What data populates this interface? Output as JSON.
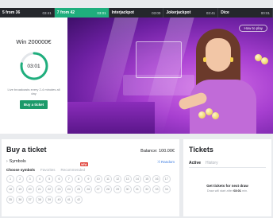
{
  "tabs": [
    {
      "label": "5 from 36",
      "time": "03:41",
      "active": false
    },
    {
      "label": "7 from 42",
      "time": "03:01",
      "active": true
    },
    {
      "label": "Interjackpot",
      "time": "03:00",
      "active": false
    },
    {
      "label": "Jokerjackpot",
      "time": "03:41",
      "active": false
    },
    {
      "label": "Dice",
      "time": "00:01",
      "active": false
    }
  ],
  "hero": {
    "win_title": "Win 200000€",
    "timer": "03:01",
    "timer_progress": 0.78,
    "note": "Live broadcasts every 2-4 minutes all day",
    "buy_button": "Buy a ticket",
    "howto_button": "How to play"
  },
  "buy": {
    "title": "Buy a ticket",
    "balance": "Balance: 100.00€",
    "symbols_label": "Symbols",
    "random_label": "Random",
    "subtabs": [
      {
        "label": "Choose symbols",
        "active": true,
        "badge": ""
      },
      {
        "label": "Favorites",
        "active": false,
        "badge": ""
      },
      {
        "label": "Recommended",
        "active": false,
        "badge": "NEW"
      }
    ],
    "numbers": [
      "1",
      "2",
      "3",
      "4",
      "5",
      "6",
      "7",
      "8",
      "9",
      "10",
      "11",
      "12",
      "13",
      "14",
      "15",
      "16",
      "17",
      "18",
      "19",
      "20",
      "21",
      "22",
      "23",
      "24",
      "25",
      "26",
      "27",
      "28",
      "29",
      "30",
      "31",
      "32",
      "33",
      "34",
      "35",
      "36",
      "37",
      "38",
      "39",
      "40",
      "41",
      "42"
    ]
  },
  "tickets": {
    "title": "Tickets",
    "tabs": [
      {
        "label": "Active",
        "active": true
      },
      {
        "label": "History",
        "active": false
      }
    ],
    "message": "Get tickets for next draw",
    "sub_prefix": "Draw will start after ",
    "sub_time": "03:01",
    "sub_suffix": " min."
  },
  "colors": {
    "accent": "#1fae7d",
    "button": "#1d9a6a",
    "link": "#3b7be0",
    "badge": "#e0443c"
  }
}
